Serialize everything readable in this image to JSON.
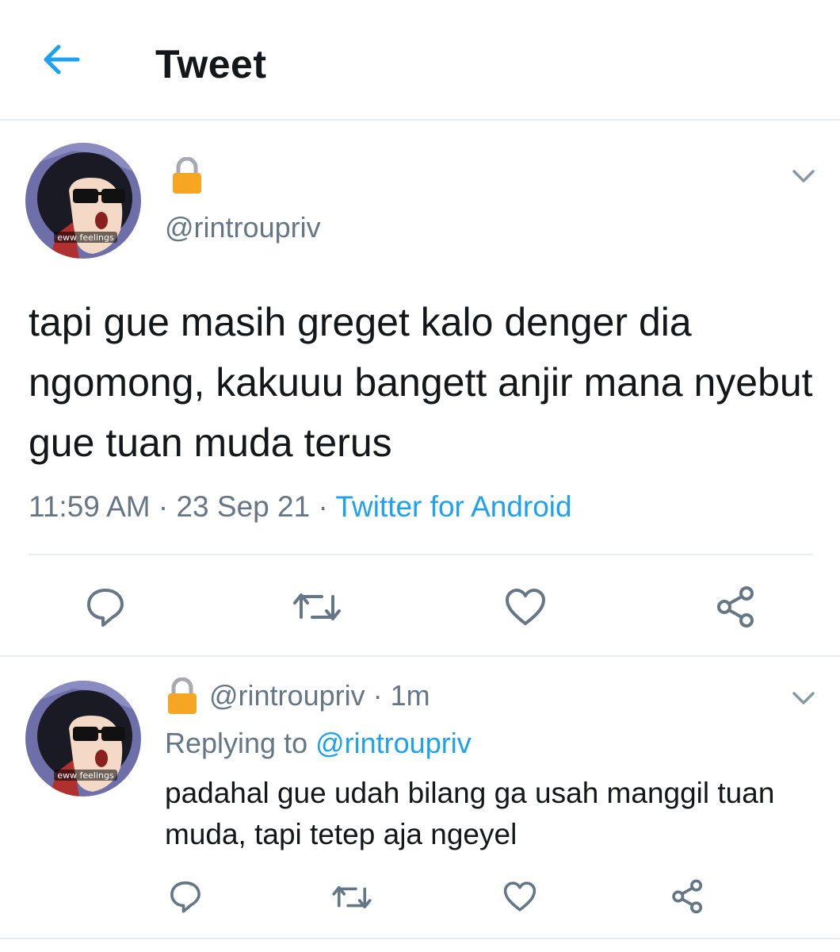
{
  "header": {
    "title": "Tweet",
    "back_icon": "arrow-left-icon"
  },
  "colors": {
    "accent": "#1da1f2",
    "secondary_text": "#657786",
    "primary_text": "#14171a",
    "divider": "#e6ecf0",
    "lock": "#f5a623"
  },
  "main_tweet": {
    "avatar_caption": "eww feelings",
    "handle": "@rintroupriv",
    "text": "tapi gue masih greget kalo denger dia ngomong, kakuuu bangett anjir mana nyebut gue tuan muda terus",
    "time": "11:59 AM",
    "separator": " · ",
    "date": "23 Sep 21",
    "source": "Twitter for Android",
    "actions": [
      "reply-icon",
      "retweet-icon",
      "like-icon",
      "share-icon"
    ]
  },
  "reply_tweet": {
    "avatar_caption": "eww feelings",
    "handle": "@rintroupriv",
    "time_ago": "1m",
    "replying_prefix": "Replying to ",
    "replying_handle": "@rintroupriv",
    "text": "padahal gue udah bilang ga usah manggil tuan muda, tapi tetep aja ngeyel",
    "actions": [
      "reply-icon",
      "retweet-icon",
      "like-icon",
      "share-icon"
    ]
  }
}
